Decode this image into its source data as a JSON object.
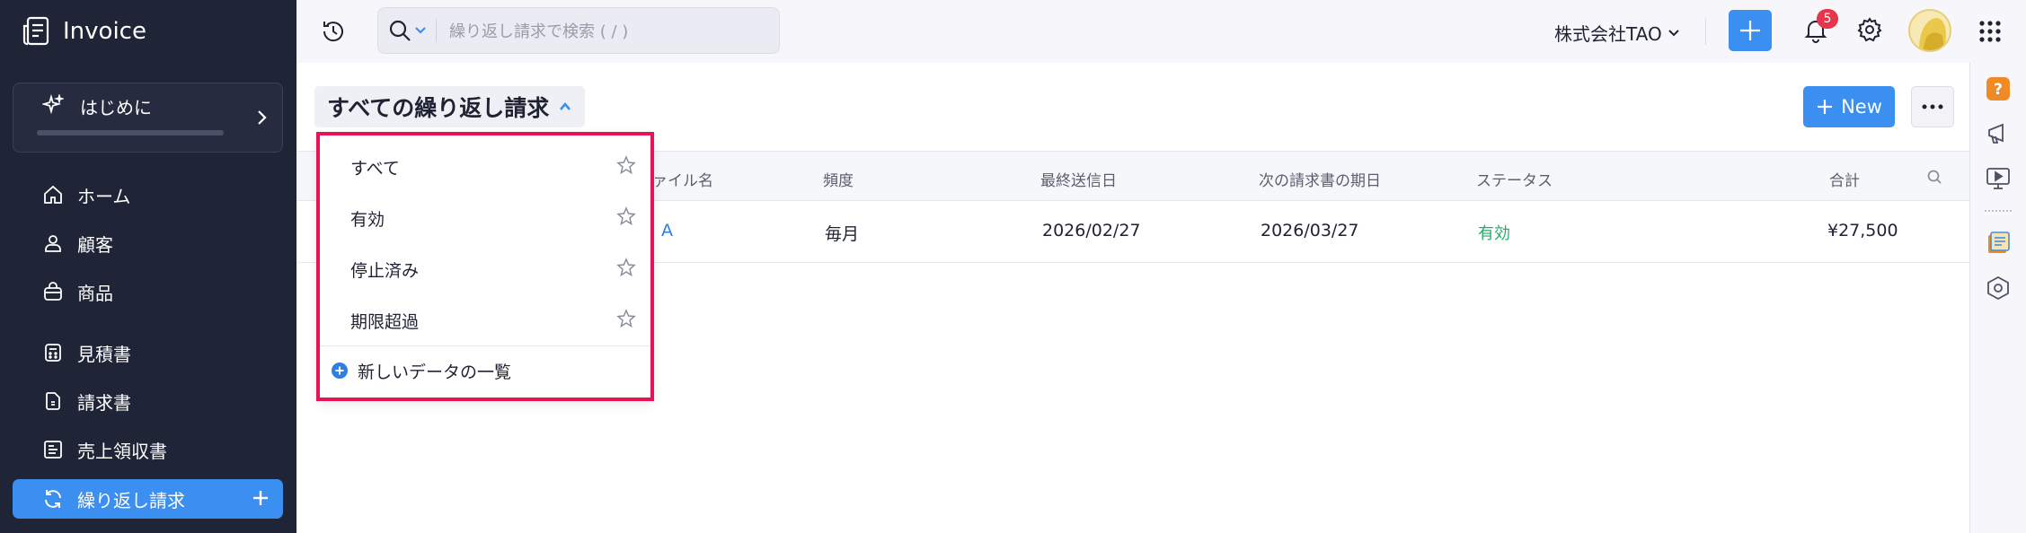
{
  "app": {
    "name": "Invoice"
  },
  "sidebar": {
    "getting_started": "はじめに",
    "items": [
      {
        "label": "ホーム",
        "icon": "home-icon"
      },
      {
        "label": "顧客",
        "icon": "user-icon"
      },
      {
        "label": "商品",
        "icon": "bag-icon"
      },
      {
        "label": "見積書",
        "icon": "calculator-icon"
      },
      {
        "label": "請求書",
        "icon": "document-icon"
      },
      {
        "label": "売上領収書",
        "icon": "receipt-icon"
      },
      {
        "label": "繰り返し請求",
        "icon": "recurring-icon",
        "active": true
      }
    ]
  },
  "topbar": {
    "search_placeholder": "繰り返し請求で検索 ( / )",
    "organization": "株式会社TAO",
    "notification_count": "5"
  },
  "main": {
    "view_title": "すべての繰り返し請求",
    "new_button": "New"
  },
  "table": {
    "headers": [
      "ァイル名",
      "頻度",
      "最終送信日",
      "次の請求書の期日",
      "ステータス",
      "合計"
    ],
    "rows": [
      {
        "name": "A",
        "frequency": "毎月",
        "last_sent": "2026/02/27",
        "next_due": "2026/03/27",
        "status": "有効",
        "total": "¥27,500"
      }
    ]
  },
  "dropdown": {
    "items": [
      "すべて",
      "有効",
      "停止済み",
      "期限超過"
    ],
    "new_view": "新しいデータの一覧"
  },
  "colors": {
    "sidebar_bg": "#1f2437",
    "accent": "#3b8ff0",
    "highlight_border": "#ea1155",
    "status_active": "#27a96c",
    "badge": "#e5364b"
  }
}
